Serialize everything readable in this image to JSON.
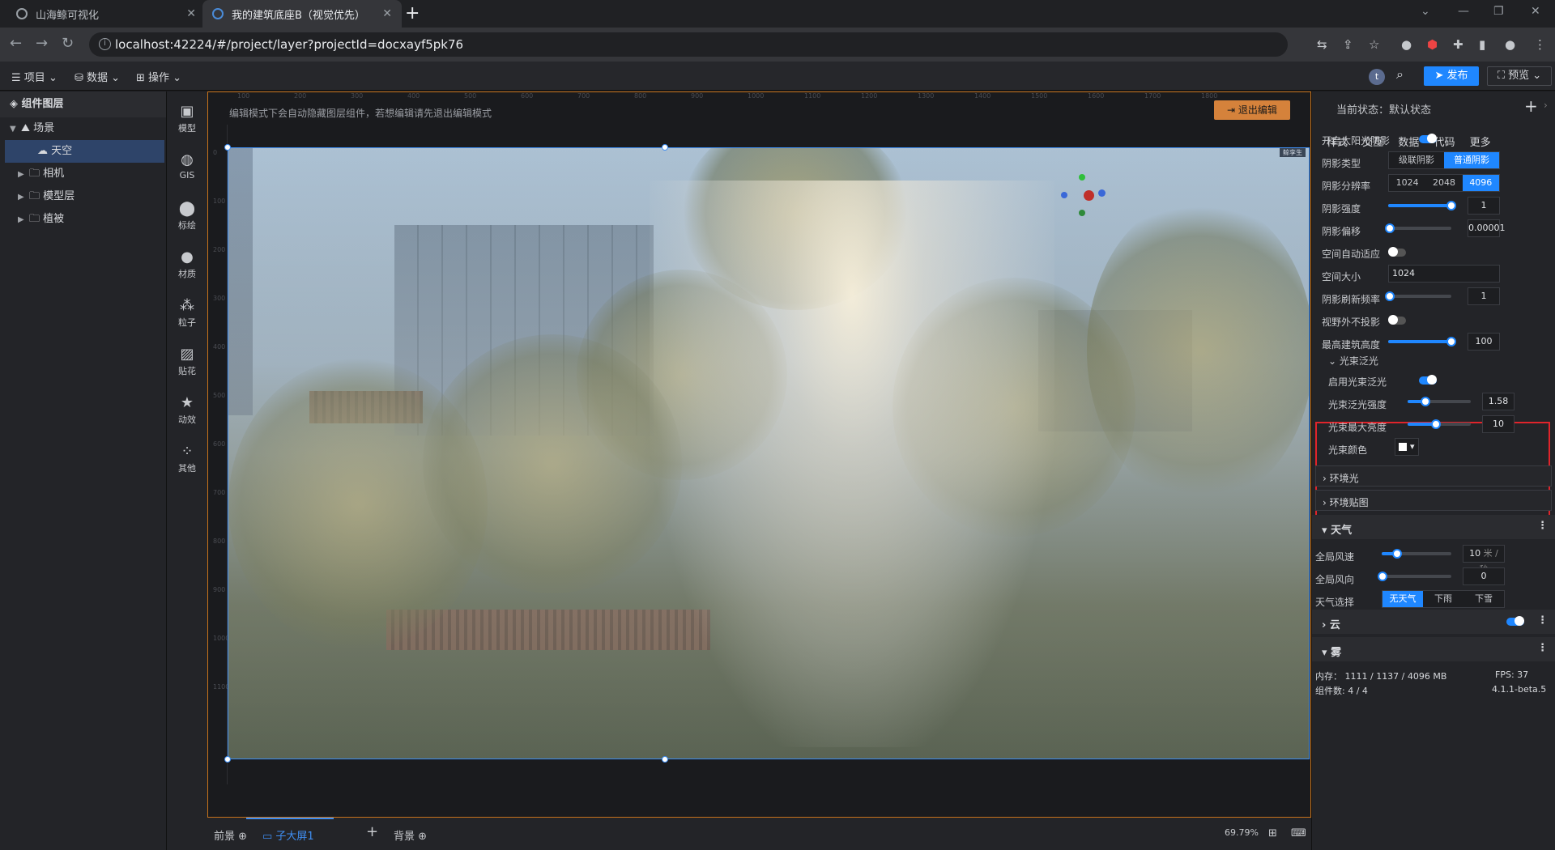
{
  "browser": {
    "tabs": [
      {
        "title": "山海鲸可视化"
      },
      {
        "title": "我的建筑底座B（视觉优先）"
      }
    ],
    "url": "localhost:42224/#/project/layer?projectId=docxayf5pk76"
  },
  "toolbar": {
    "menus": [
      "项目",
      "数据",
      "操作"
    ],
    "avatar_letter": "t",
    "publish_label": "发布",
    "preview_label": "预览"
  },
  "left_panel": {
    "title": "组件图层",
    "tree": [
      {
        "label": "场景"
      },
      {
        "label": "天空"
      },
      {
        "label": "相机"
      },
      {
        "label": "模型层"
      },
      {
        "label": "植被"
      }
    ]
  },
  "tools": [
    "模型",
    "GIS",
    "标绘",
    "材质",
    "粒子",
    "贴花",
    "动效",
    "其他"
  ],
  "stage": {
    "hint": "编辑模式下会自动隐藏图层组件，若想编辑请先退出编辑模式",
    "exit_label": "退出编辑",
    "ruler_top": [
      "100",
      "200",
      "300",
      "400",
      "500",
      "600",
      "700",
      "800",
      "900",
      "1000",
      "1100",
      "1200",
      "1300",
      "1400",
      "1500",
      "1600",
      "1700",
      "1800"
    ],
    "ruler_left": [
      "0",
      "100",
      "200",
      "300",
      "400",
      "500",
      "600",
      "700",
      "800",
      "900",
      "1000",
      "1100"
    ],
    "badge": "鲸孪生"
  },
  "bottom": {
    "foreground": "前景",
    "screen": "子大屏1",
    "background": "背景",
    "zoom": "69.79%"
  },
  "right_panel": {
    "state_label": "当前状态：",
    "state_value": "默认状态",
    "tabs": [
      "样式",
      "交互",
      "数据",
      "代码",
      "更多"
    ],
    "sun_shadow": "开启太阳光阴影",
    "shadow_type_label": "阴影类型",
    "shadow_type_options": [
      "级联阴影",
      "普通阴影"
    ],
    "shadow_res_label": "阴影分辨率",
    "shadow_res_options": [
      "1024",
      "2048",
      "4096"
    ],
    "shadow_strength_label": "阴影强度",
    "shadow_strength_value": "1",
    "shadow_offset_label": "阴影偏移",
    "shadow_offset_value": "0.00001",
    "space_adapt_label": "空间自动适应",
    "space_size_label": "空间大小",
    "space_size_value": "1024",
    "shadow_refresh_label": "阴影刷新频率",
    "shadow_refresh_value": "1",
    "outview_label": "视野外不投影",
    "max_height_label": "最高建筑高度",
    "max_height_value": "100",
    "bloom_title": "光束泛光",
    "bloom_enable_label": "启用光束泛光",
    "bloom_strength_label": "光束泛光强度",
    "bloom_strength_value": "1.58",
    "bloom_brightness_label": "光束最大亮度",
    "bloom_brightness_value": "10",
    "bloom_color_label": "光束颜色",
    "ambient_label": "环境光",
    "env_map_label": "环境贴图",
    "weather_title": "天气",
    "wind_speed_label": "全局风速",
    "wind_speed_value": "10",
    "wind_speed_unit": "米 / 秒",
    "wind_dir_label": "全局风向",
    "wind_dir_value": "0",
    "weather_select_label": "天气选择",
    "weather_options": [
      "无天气",
      "下雨",
      "下雪"
    ],
    "cloud_title": "云",
    "fog_title": "雾",
    "memory": "内存：  1111 / 1137 / 4096 MB",
    "fps": "FPS:   37",
    "components": "组件数: 4 / 4",
    "version": "4.1.1-beta.5"
  },
  "colors": {
    "accent": "#1f87ff",
    "highlight": "#e0242b",
    "exit": "#d5823b"
  }
}
